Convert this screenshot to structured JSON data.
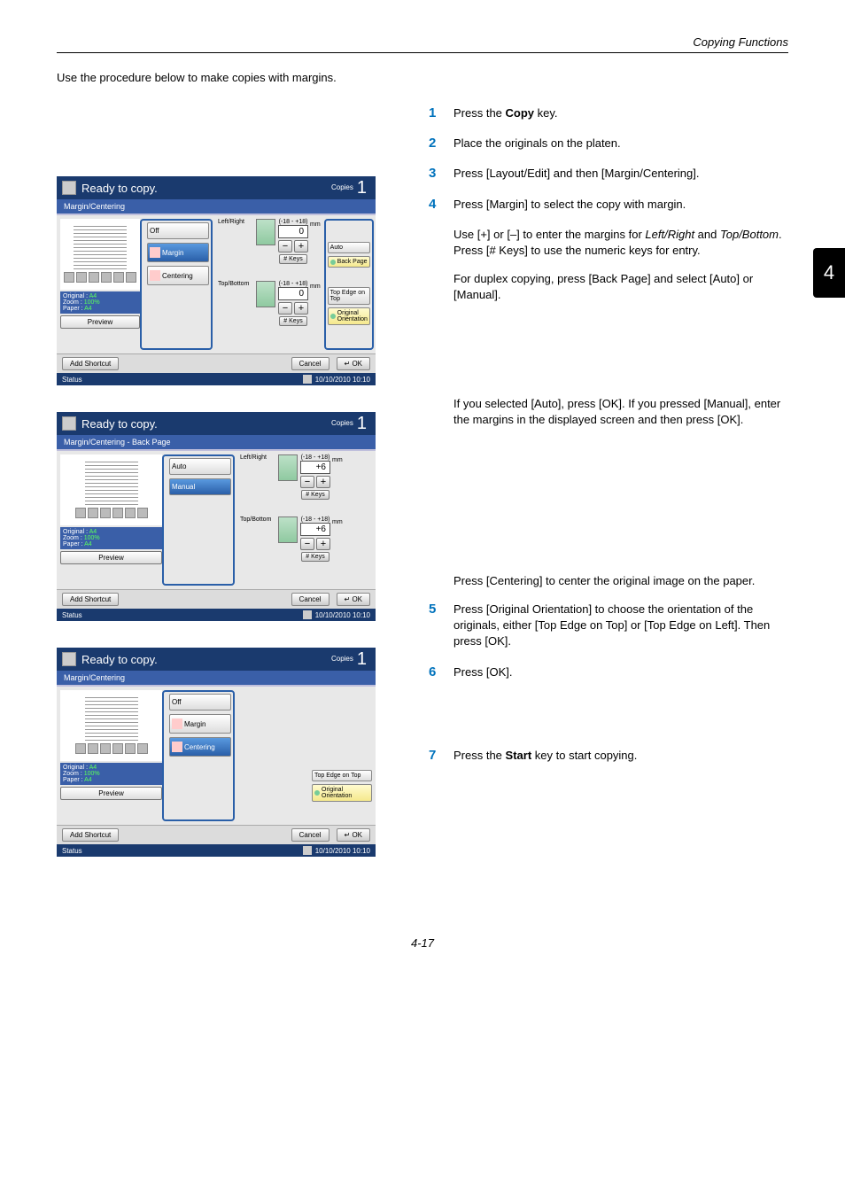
{
  "header": {
    "section": "Copying Functions"
  },
  "intro": "Use the procedure below to make copies with margins.",
  "tab_num": "4",
  "steps": {
    "s1": {
      "n": "1",
      "t_pre": "Press the ",
      "t_bold": "Copy",
      "t_post": " key."
    },
    "s2": {
      "n": "2",
      "t": "Place the originals on the platen."
    },
    "s3": {
      "n": "3",
      "t": "Press [Layout/Edit] and then [Margin/Centering]."
    },
    "s4": {
      "n": "4",
      "t": "Press [Margin] to select the copy with margin."
    },
    "s4a": {
      "pre": "Use [+] or [–] to enter the margins for ",
      "i1": "Left/Right",
      "mid": " and ",
      "i2": "Top/Bottom",
      "post": ". Press [# Keys] to use the numeric keys for entry."
    },
    "s4b": "For duplex copying, press [Back Page] and select [Auto] or [Manual].",
    "s4c": "If you selected [Auto], press [OK]. If you pressed [Manual], enter the margins in the displayed screen and then press [OK].",
    "s4d": "Press [Centering] to center the original image on the paper.",
    "s5": {
      "n": "5",
      "t": "Press [Original Orientation] to choose the orientation of the originals, either [Top Edge on Top] or [Top Edge on Left]. Then press [OK]."
    },
    "s6": {
      "n": "6",
      "t": "Press [OK]."
    },
    "s7": {
      "n": "7",
      "t_pre": "Press the ",
      "t_bold": "Start",
      "t_post": " key to start copying."
    }
  },
  "panel_common": {
    "title": "Ready to copy.",
    "copies_label": "Copies",
    "copies_val": "1",
    "original": "Original",
    "zoom": "Zoom",
    "paper": "Paper",
    "a4": "A4",
    "pct": "100%",
    "preview": "Preview",
    "add_shortcut": "Add Shortcut",
    "cancel": "Cancel",
    "ok": "OK",
    "status": "Status",
    "timestamp": "10/10/2010 10:10",
    "left_right": "Left/Right",
    "top_bottom": "Top/Bottom",
    "range": "(-18 - +18)",
    "keys": "# Keys",
    "mm": "mm"
  },
  "p1": {
    "sub": "Margin/Centering",
    "off": "Off",
    "margin": "Margin",
    "centering": "Centering",
    "lr_val": "0",
    "tb_val": "0",
    "auto": "Auto",
    "back_page": "Back Page",
    "top_edge": "Top Edge on Top",
    "orient": "Original Orientation"
  },
  "p2": {
    "sub": "Margin/Centering - Back Page",
    "auto": "Auto",
    "manual": "Manual",
    "lr_val": "+6",
    "tb_val": "+6"
  },
  "p3": {
    "sub": "Margin/Centering",
    "off": "Off",
    "margin": "Margin",
    "centering": "Centering",
    "top_edge": "Top Edge on Top",
    "orient": "Original Orientation"
  },
  "page_number": "4-17"
}
